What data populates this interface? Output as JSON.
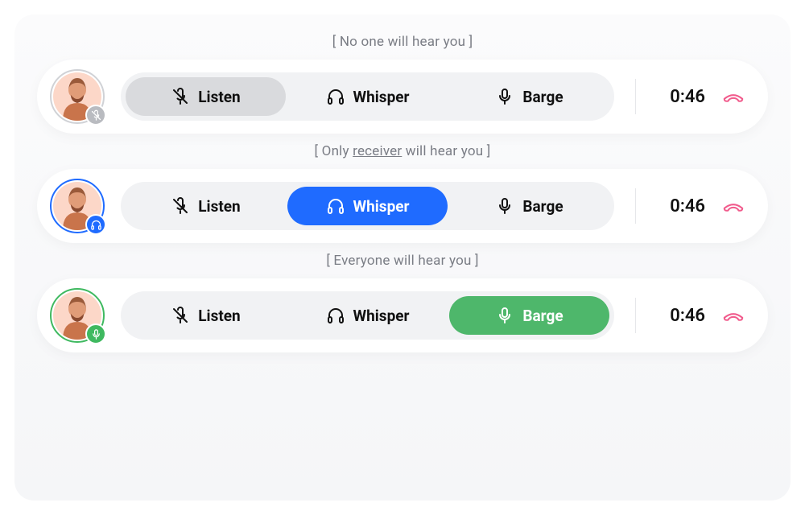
{
  "captions": {
    "listen": "[ No one will hear you ]",
    "whisper_pre": "[ Only ",
    "whisper_uline": "receiver",
    "whisper_post": " will hear you ]",
    "barge": "[ Everyone will hear you ]"
  },
  "segments": {
    "listen": "Listen",
    "whisper": "Whisper",
    "barge": "Barge"
  },
  "rows": [
    {
      "mode": "listen",
      "timer": "0:46",
      "ring": "#d0d2d6",
      "badge_bg": "#b9bbc0",
      "badge_icon": "mic-off"
    },
    {
      "mode": "whisper",
      "timer": "0:46",
      "ring": "#1f6bff",
      "badge_bg": "#1f6bff",
      "badge_icon": "headphones"
    },
    {
      "mode": "barge",
      "timer": "0:46",
      "ring": "#3fb960",
      "badge_bg": "#3fb960",
      "badge_icon": "mic"
    }
  ],
  "colors": {
    "hangup": "#f15c8d"
  }
}
